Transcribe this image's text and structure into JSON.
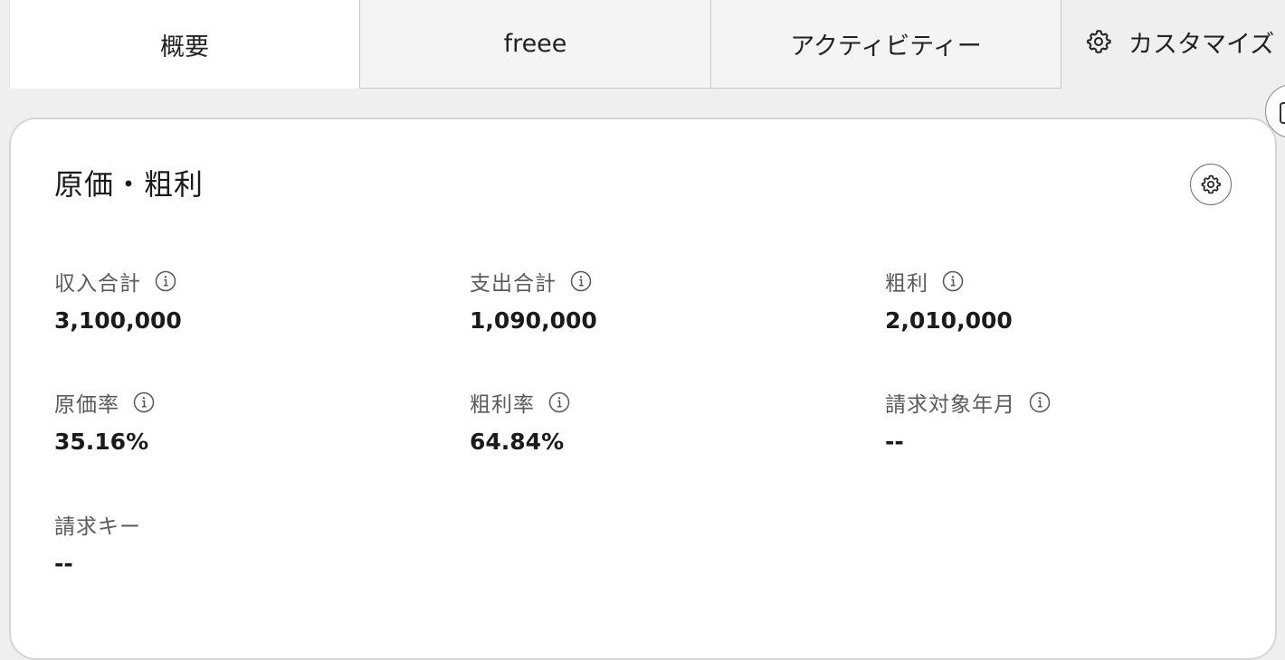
{
  "tabs": [
    {
      "label": "概要",
      "active": true
    },
    {
      "label": "freee",
      "active": false
    },
    {
      "label": "アクティビティー",
      "active": false
    }
  ],
  "customize": {
    "label": "カスタマイズ",
    "icon": "gear-icon"
  },
  "card": {
    "title": "原価・粗利",
    "settings_icon": "gear-icon",
    "stats": [
      {
        "label": "収入合計",
        "value": "3,100,000",
        "has_info": true
      },
      {
        "label": "支出合計",
        "value": "1,090,000",
        "has_info": true
      },
      {
        "label": "粗利",
        "value": "2,010,000",
        "has_info": true
      },
      {
        "label": "原価率",
        "value": "35.16%",
        "has_info": true
      },
      {
        "label": "粗利率",
        "value": "64.84%",
        "has_info": true
      },
      {
        "label": "請求対象年月",
        "value": "--",
        "has_info": true
      },
      {
        "label": "請求キー",
        "value": "--",
        "has_info": false
      }
    ]
  },
  "colors": {
    "page_background": "#efefef",
    "card_background": "#ffffff",
    "label_text": "#5a5a5a",
    "value_text": "#1b1b1b",
    "border": "#d6d6d6"
  }
}
